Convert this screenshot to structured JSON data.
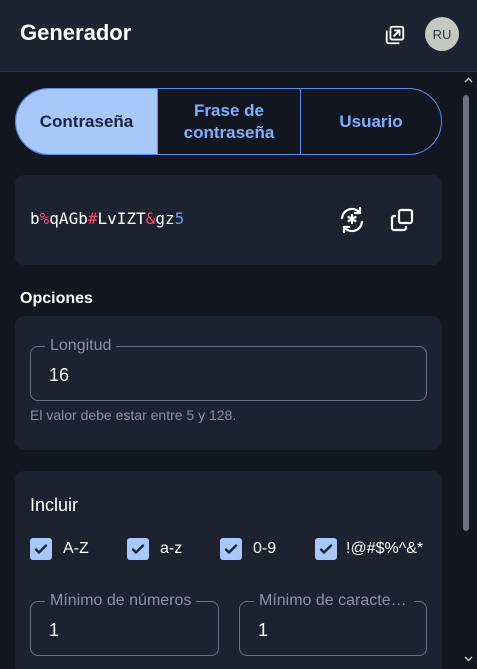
{
  "header": {
    "title": "Generador",
    "popout_icon": "popout-icon",
    "avatar_initials": "RU"
  },
  "tabs": [
    {
      "label": "Contraseña",
      "selected": true
    },
    {
      "label": "Frase de contraseña",
      "selected": false
    },
    {
      "label": "Usuario",
      "selected": false
    }
  ],
  "password": {
    "value": "b%qAGb#LvIZT&gz5",
    "regenerate_icon": "regenerate-icon",
    "copy_icon": "copy-icon"
  },
  "options": {
    "heading": "Opciones",
    "length_label": "Longitud",
    "length_value": "16",
    "length_hint": "El valor debe estar entre 5 y 128."
  },
  "include": {
    "heading": "Incluir",
    "checkboxes": [
      {
        "label": "A-Z",
        "checked": true
      },
      {
        "label": "a-z",
        "checked": true
      },
      {
        "label": "0-9",
        "checked": true
      },
      {
        "label": "!@#$%^&*",
        "checked": true
      }
    ],
    "min_numbers_label": "Mínimo de números",
    "min_numbers_value": "1",
    "min_special_label": "Mínimo de caracteres especiales",
    "min_special_value": "1"
  },
  "colors": {
    "accent": "#a8c8fb",
    "accent_text": "#7eb0ff",
    "special_char": "#ff4d6d",
    "digit_char": "#6b9bff",
    "background": "#111620",
    "card": "#1c2230"
  }
}
